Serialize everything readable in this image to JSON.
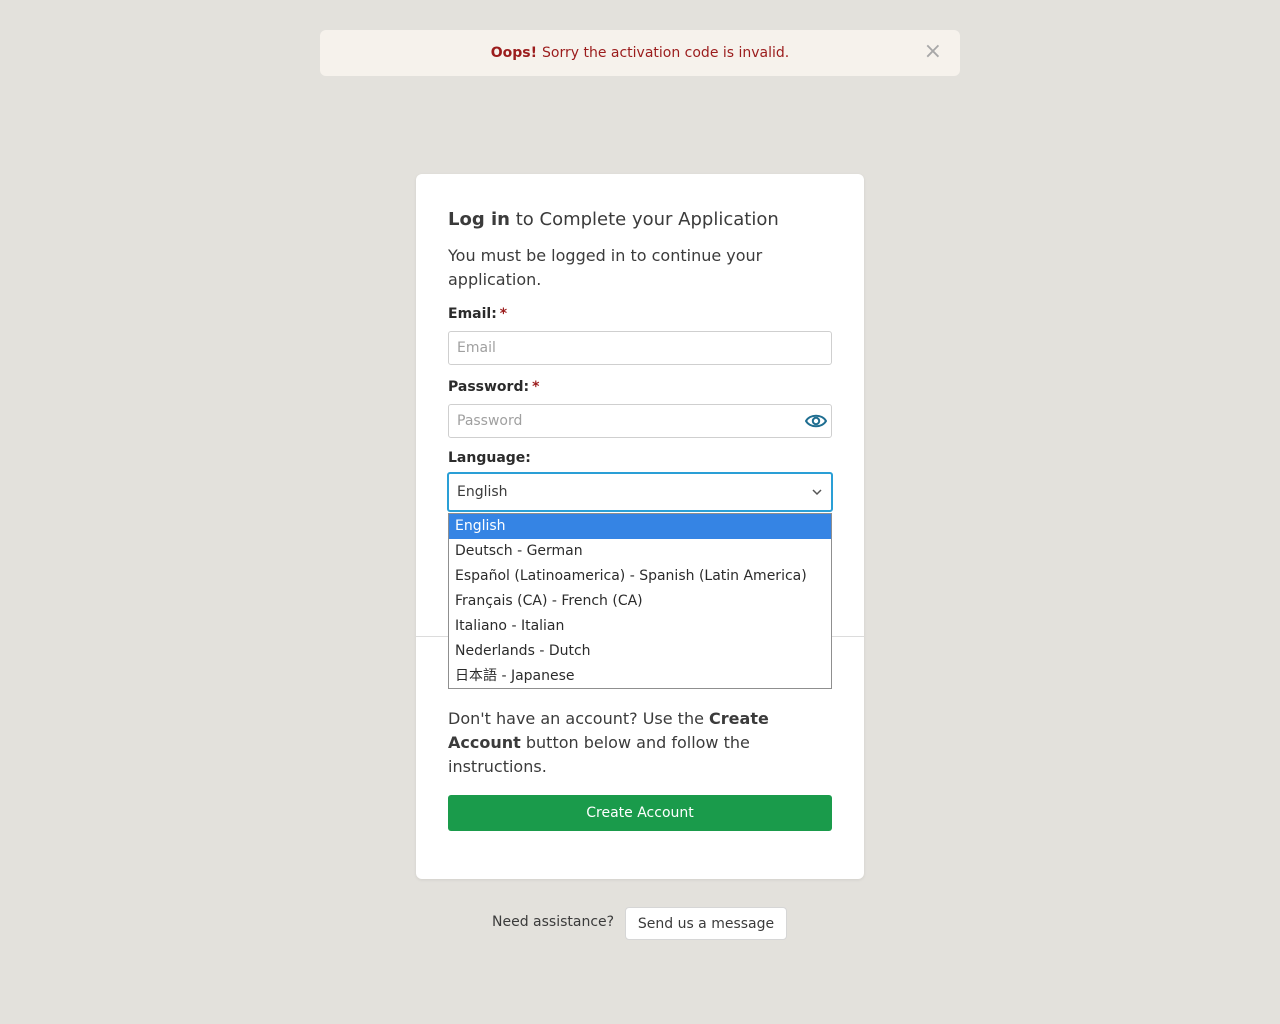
{
  "alert": {
    "strong": "Oops!",
    "message": "Sorry the activation code is invalid.",
    "close": "×"
  },
  "login": {
    "title_strong": "Log in",
    "title_rest": " to Complete your Application",
    "intro": "You must be logged in to continue your application.",
    "email_label": "Email:",
    "email_placeholder": "Email",
    "password_label": "Password:",
    "password_placeholder": "Password",
    "required_mark": "*",
    "language_label": "Language:",
    "language_selected": "English"
  },
  "language_options": [
    "English",
    "Deutsch - German",
    "Español (Latinoamerica) - Spanish (Latin America)",
    "Français (CA) - French (CA)",
    "Italiano - Italian",
    "Nederlands - Dutch",
    "日本語 - Japanese"
  ],
  "signup": {
    "text_1": "Don't have an account? Use the ",
    "text_strong": "Create Account",
    "text_2": " button below and follow the instructions.",
    "button": "Create Account"
  },
  "help": {
    "text": "Need assistance?",
    "button": "Send us a message"
  },
  "colors": {
    "background": "#e3e1dc",
    "error": "#9b1c1c",
    "primary_green": "#1a9b4b",
    "focus_blue": "#2a9fd6",
    "selected_option": "#3584e4"
  },
  "icons": {
    "close": "close-icon",
    "password_toggle": "eye-icon",
    "select_arrow": "chevron-down-icon"
  }
}
